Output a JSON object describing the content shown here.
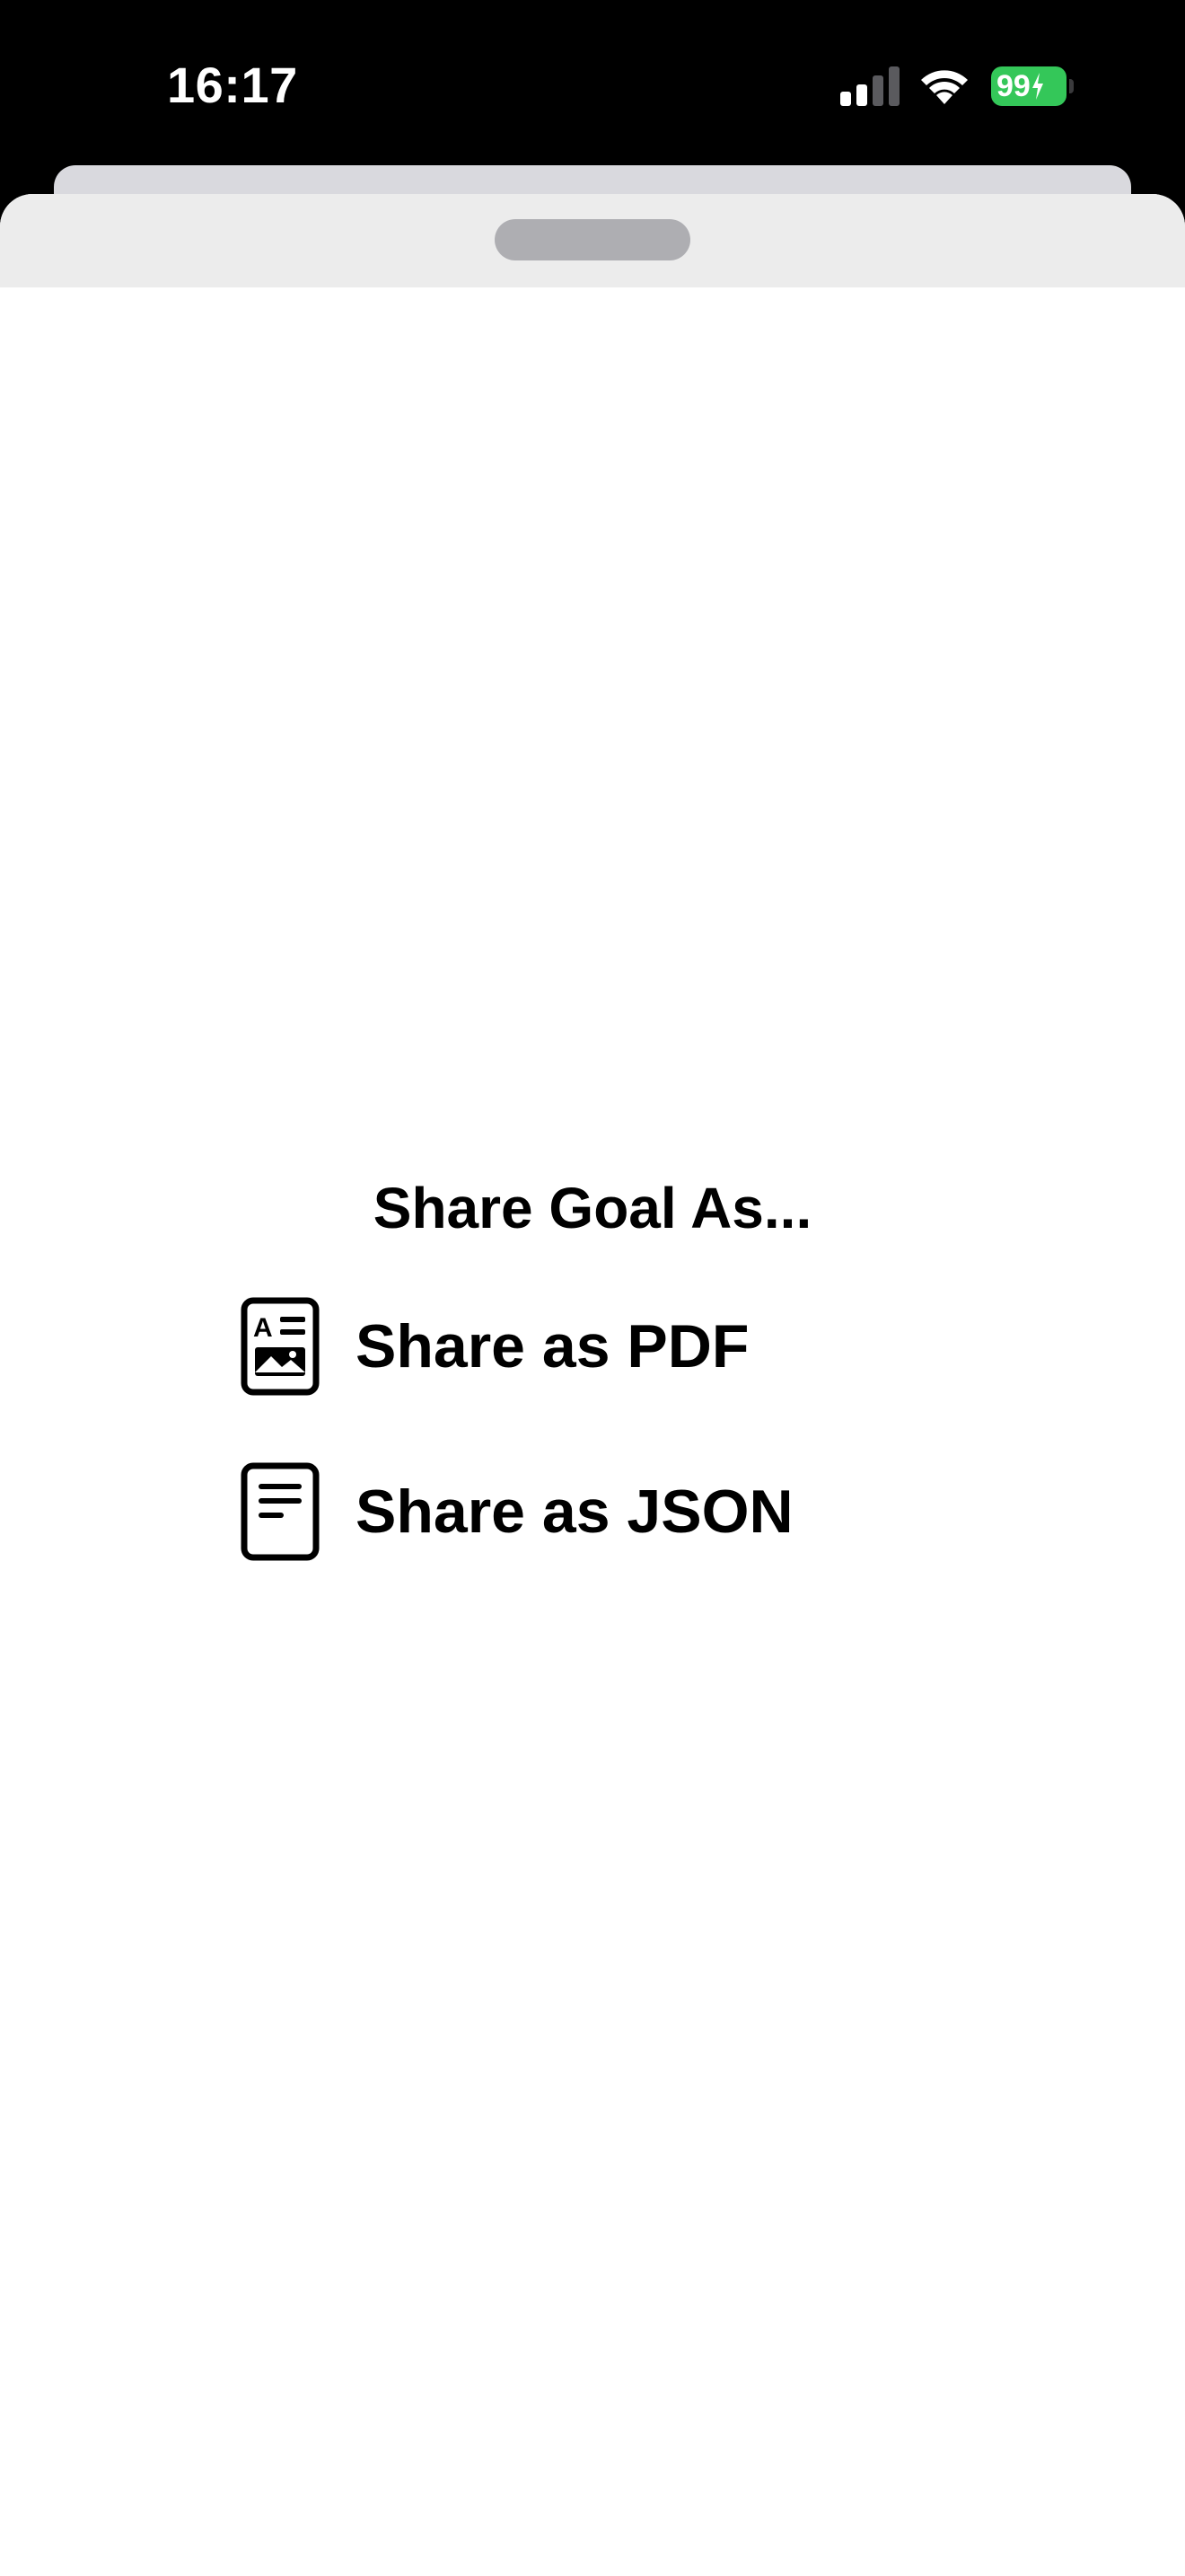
{
  "status_bar": {
    "time": "16:17",
    "battery_level": "99",
    "signal_bars_active": 2,
    "signal_bars_total": 4
  },
  "sheet": {
    "title": "Share Goal As...",
    "options": [
      {
        "label": "Share as PDF",
        "icon": "document-image-icon"
      },
      {
        "label": "Share as JSON",
        "icon": "document-text-icon"
      }
    ]
  },
  "colors": {
    "battery": "#34c759",
    "sheet_header": "#ececec",
    "grabber": "#aeaeb2"
  }
}
